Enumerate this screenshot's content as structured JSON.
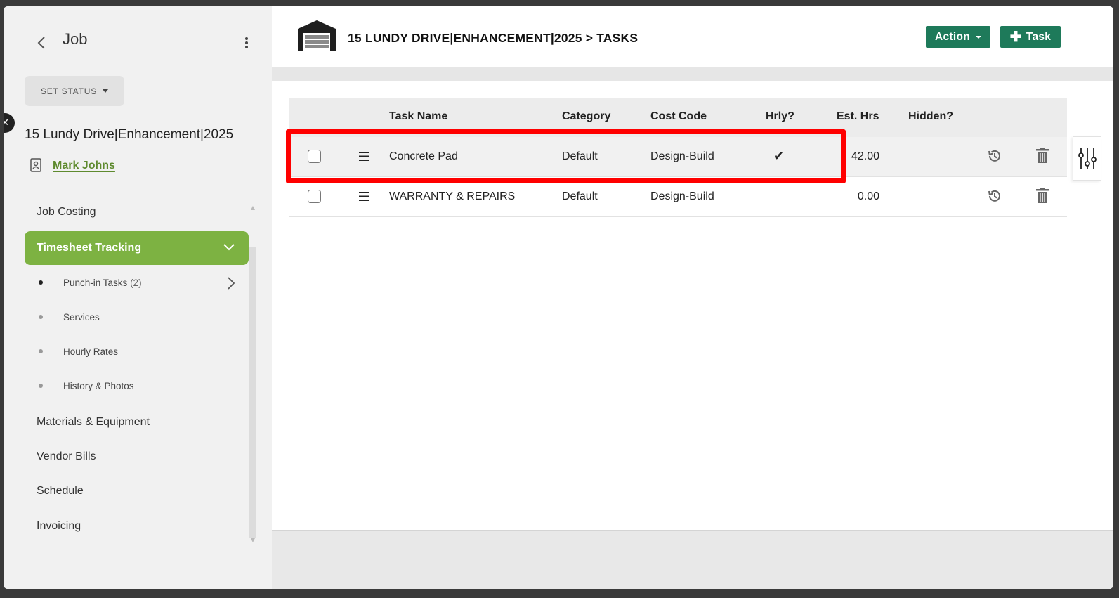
{
  "sidebar": {
    "title": "Job",
    "set_status_label": "SET STATUS",
    "job_name": "15 Lundy Drive|Enhancement|2025",
    "contact_name": "Mark Johns",
    "nav": {
      "job_costing": "Job Costing",
      "timesheet_tracking": "Timesheet Tracking",
      "materials_equipment": "Materials & Equipment",
      "vendor_bills": "Vendor Bills",
      "schedule": "Schedule",
      "invoicing": "Invoicing"
    },
    "sub_items": {
      "punch_in_tasks": "Punch-in Tasks",
      "punch_in_count": "(2)",
      "services": "Services",
      "hourly_rates": "Hourly Rates",
      "history_photos": "History & Photos"
    }
  },
  "header": {
    "title": "15 LUNDY DRIVE|ENHANCEMENT|2025 > TASKS",
    "action_button": "Action",
    "task_button": "Task"
  },
  "table": {
    "columns": {
      "task_name": "Task Name",
      "category": "Category",
      "cost_code": "Cost Code",
      "hourly": "Hrly?",
      "est_hrs": "Est. Hrs",
      "hidden": "Hidden?"
    },
    "rows": [
      {
        "task_name": "Concrete Pad",
        "category": "Default",
        "cost_code": "Design-Build",
        "hourly": "✔",
        "est_hrs": "42.00"
      },
      {
        "task_name": "WARRANTY & REPAIRS",
        "category": "Default",
        "cost_code": "Design-Build",
        "hourly": "",
        "est_hrs": "0.00"
      }
    ]
  },
  "colors": {
    "accent_green": "#7db242",
    "button_green": "#1e7a5a",
    "link_green": "#5e8a2e",
    "highlight_red": "#ff0000"
  },
  "icons": [
    "back-icon",
    "more-vertical-icon",
    "close-icon",
    "contact-card-icon",
    "chevron-down-icon",
    "chevron-right-icon",
    "garage-icon",
    "plus-icon",
    "drag-handle-icon",
    "checkmark-icon",
    "history-icon",
    "trash-icon",
    "filter-sliders-icon"
  ]
}
